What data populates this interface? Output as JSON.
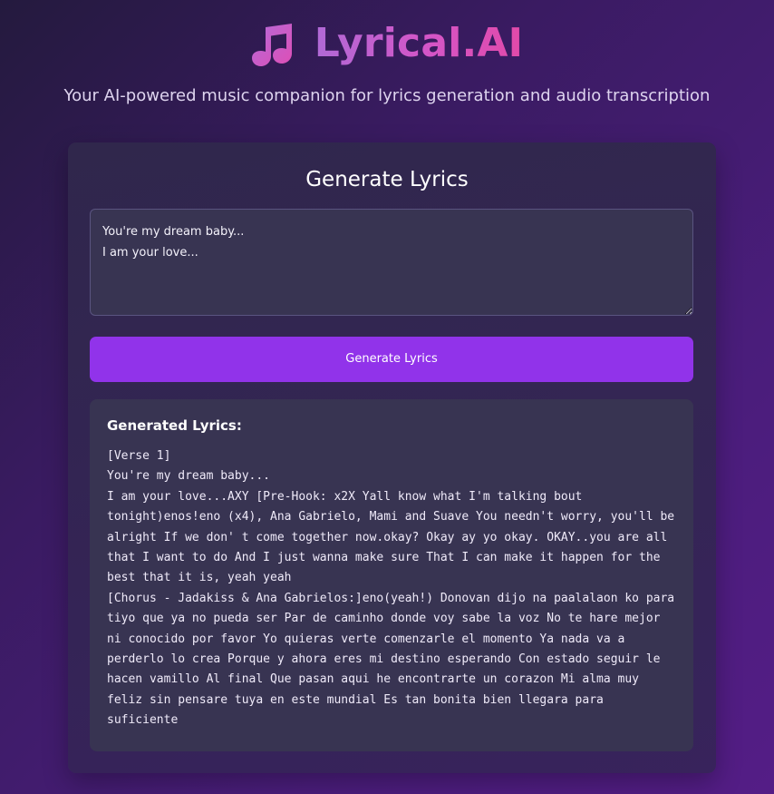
{
  "header": {
    "icon": "music-notes-icon",
    "title": "Lyrical.AI",
    "subtitle": "Your AI-powered music companion for lyrics generation and audio transcription"
  },
  "generator": {
    "section_title": "Generate Lyrics",
    "prompt_value": "You're my dream baby...\nI am your love...",
    "button_label": "Generate Lyrics"
  },
  "output": {
    "title": "Generated Lyrics:",
    "lyrics": "[Verse 1]\nYou're my dream baby...\nI am your love...AXY [Pre-Hook: x2X Yall know what I'm talking bout tonight)enos!eno (x4), Ana Gabrielo, Mami and Suave You needn't worry, you'll be alright If we don' t come together now.okay? Okay ay yo okay. OKAY..you are all that I want to do And I just wanna make sure That I can make it happen for the best that it is, yeah yeah\n[Chorus - Jadakiss & Ana Gabrielos:]eno(yeah!) Donovan dijo na paalalaon ko para tiyo que ya no pueda ser Par de caminho donde voy sabe la voz No te hare mejor ni conocido por favor Yo quieras verte comenzarle el momento Ya nada va a perderlo lo crea Porque y ahora eres mi destino esperando Con estado seguir le hacen vamillo Al final Que pasan aqui he encontrarte un corazon Mi alma muy feliz sin pensare tuya en este mundial Es tan bonita bien llegara para suficiente"
  },
  "colors": {
    "accent": "#9133ea",
    "brand_gradient_start": "#b06ad6",
    "brand_gradient_end": "#e24aa9"
  }
}
